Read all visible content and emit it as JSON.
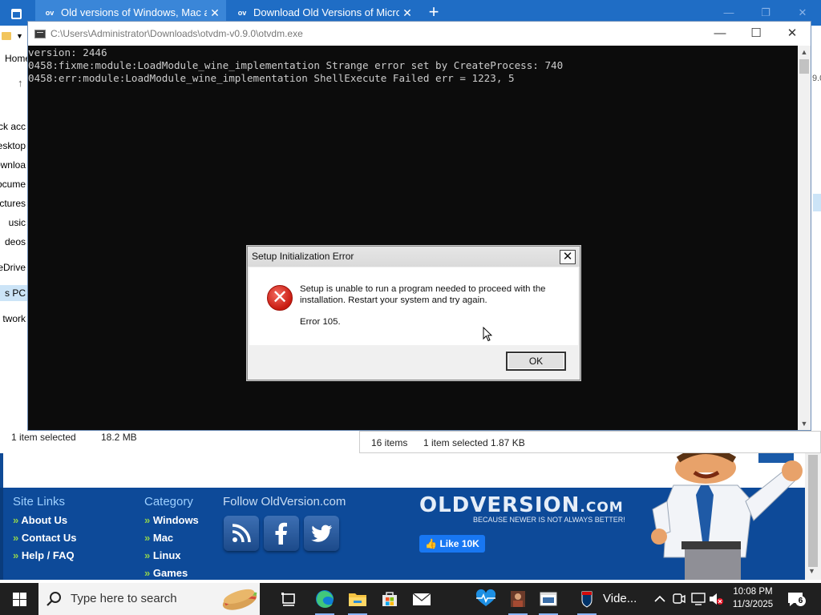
{
  "browser": {
    "tabs": [
      {
        "favicon": "ov",
        "title": "Old versions of Windows, Mac an",
        "close": "✕"
      },
      {
        "favicon": "ov",
        "title": "Download Old Versions of Micros",
        "close": "✕"
      }
    ],
    "new_tab": "+"
  },
  "explorer": {
    "home_label": "Home",
    "nav_items": [
      "ck acc",
      "esktop",
      "ownloa",
      "ocume",
      "ctures",
      "usic",
      "deos",
      "eDrive",
      "s PC",
      "twork"
    ],
    "selected_nav_item": "s PC",
    "status_left": {
      "count": "1 item selected",
      "size": "18.2 MB"
    },
    "status_right": {
      "items": "16 items",
      "selected": "1 item selected",
      "size": "1.87 KB"
    },
    "right_edge_text": "9.0"
  },
  "console": {
    "title": "C:\\Users\\Administrator\\Downloads\\otvdm-v0.9.0\\otvdm.exe",
    "lines": [
      "version: 2446",
      "0458:fixme:module:LoadModule_wine_implementation Strange error set by CreateProcess: 740",
      "0458:err:module:LoadModule_wine_implementation ShellExecute Failed err = 1223, 5"
    ]
  },
  "dialog": {
    "title": "Setup Initialization Error",
    "message": "Setup is unable to run a program needed to proceed with the installation. Restart your system and try again.",
    "error_code": "Error 105.",
    "ok_label": "OK",
    "close_glyph": "✕"
  },
  "site": {
    "site_links": {
      "heading": "Site Links",
      "items": [
        "About Us",
        "Contact Us",
        "Help / FAQ"
      ]
    },
    "category": {
      "heading": "Category",
      "items": [
        "Windows",
        "Mac",
        "Linux",
        "Games"
      ]
    },
    "follow_heading": "Follow OldVersion.com",
    "bullet": "»",
    "logo_main": "OLDVERSION",
    "logo_suffix": ".COM",
    "tagline": "BECAUSE NEWER IS NOT ALWAYS BETTER!",
    "fb_like": "Like 10K"
  },
  "taskbar": {
    "search_placeholder": "Type here to search",
    "video_label": "Vide...",
    "time": "10:08 PM",
    "date": "11/3/2025",
    "notification_count": "6"
  },
  "colors": {
    "browser_tabbar": "#1f6dc5",
    "site_footer": "#0d4a99",
    "console_bg": "#0c0c0c",
    "taskbar": "#202020",
    "error_red": "#c81a10"
  },
  "icons": [
    "task-view-icon",
    "search-icon",
    "edge-icon",
    "file-explorer-icon",
    "store-icon",
    "mail-icon",
    "health-icon",
    "app-icon",
    "console-icon",
    "nfl-icon",
    "chevron-up-icon",
    "network-icon",
    "volume-muted-icon",
    "notification-icon",
    "error-icon",
    "rss-icon",
    "facebook-icon",
    "twitter-icon"
  ]
}
